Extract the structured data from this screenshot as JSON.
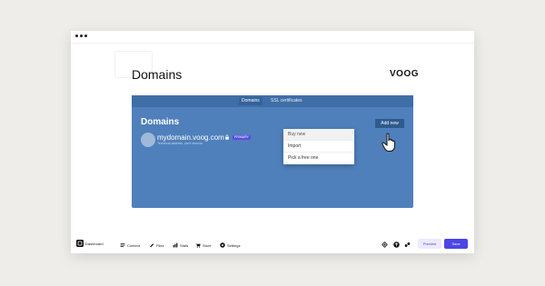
{
  "page": {
    "title": "Domains",
    "brand": "VOOG"
  },
  "tabs": [
    {
      "label": "Domains",
      "active": true
    },
    {
      "label": "SSL certificates",
      "active": false
    }
  ],
  "panel": {
    "heading": "Domains",
    "add_button": "Add new",
    "domain": {
      "name": "mydomain.voog.com",
      "badge": "PRIMARY",
      "subtitle": "Technical address, can't remove"
    }
  },
  "dropdown": {
    "items": [
      "Buy new",
      "Import",
      "Pick a free one"
    ]
  },
  "bottombar": {
    "dashboard": "Dashboard",
    "content": "Content",
    "files": "Files",
    "stats": "Stats",
    "store": "Store",
    "settings": "Settings",
    "preview": "Preview",
    "save": "Save"
  },
  "colors": {
    "panel": "#4f80bb",
    "accent": "#4d45e6",
    "badge": "#5b4de0"
  }
}
